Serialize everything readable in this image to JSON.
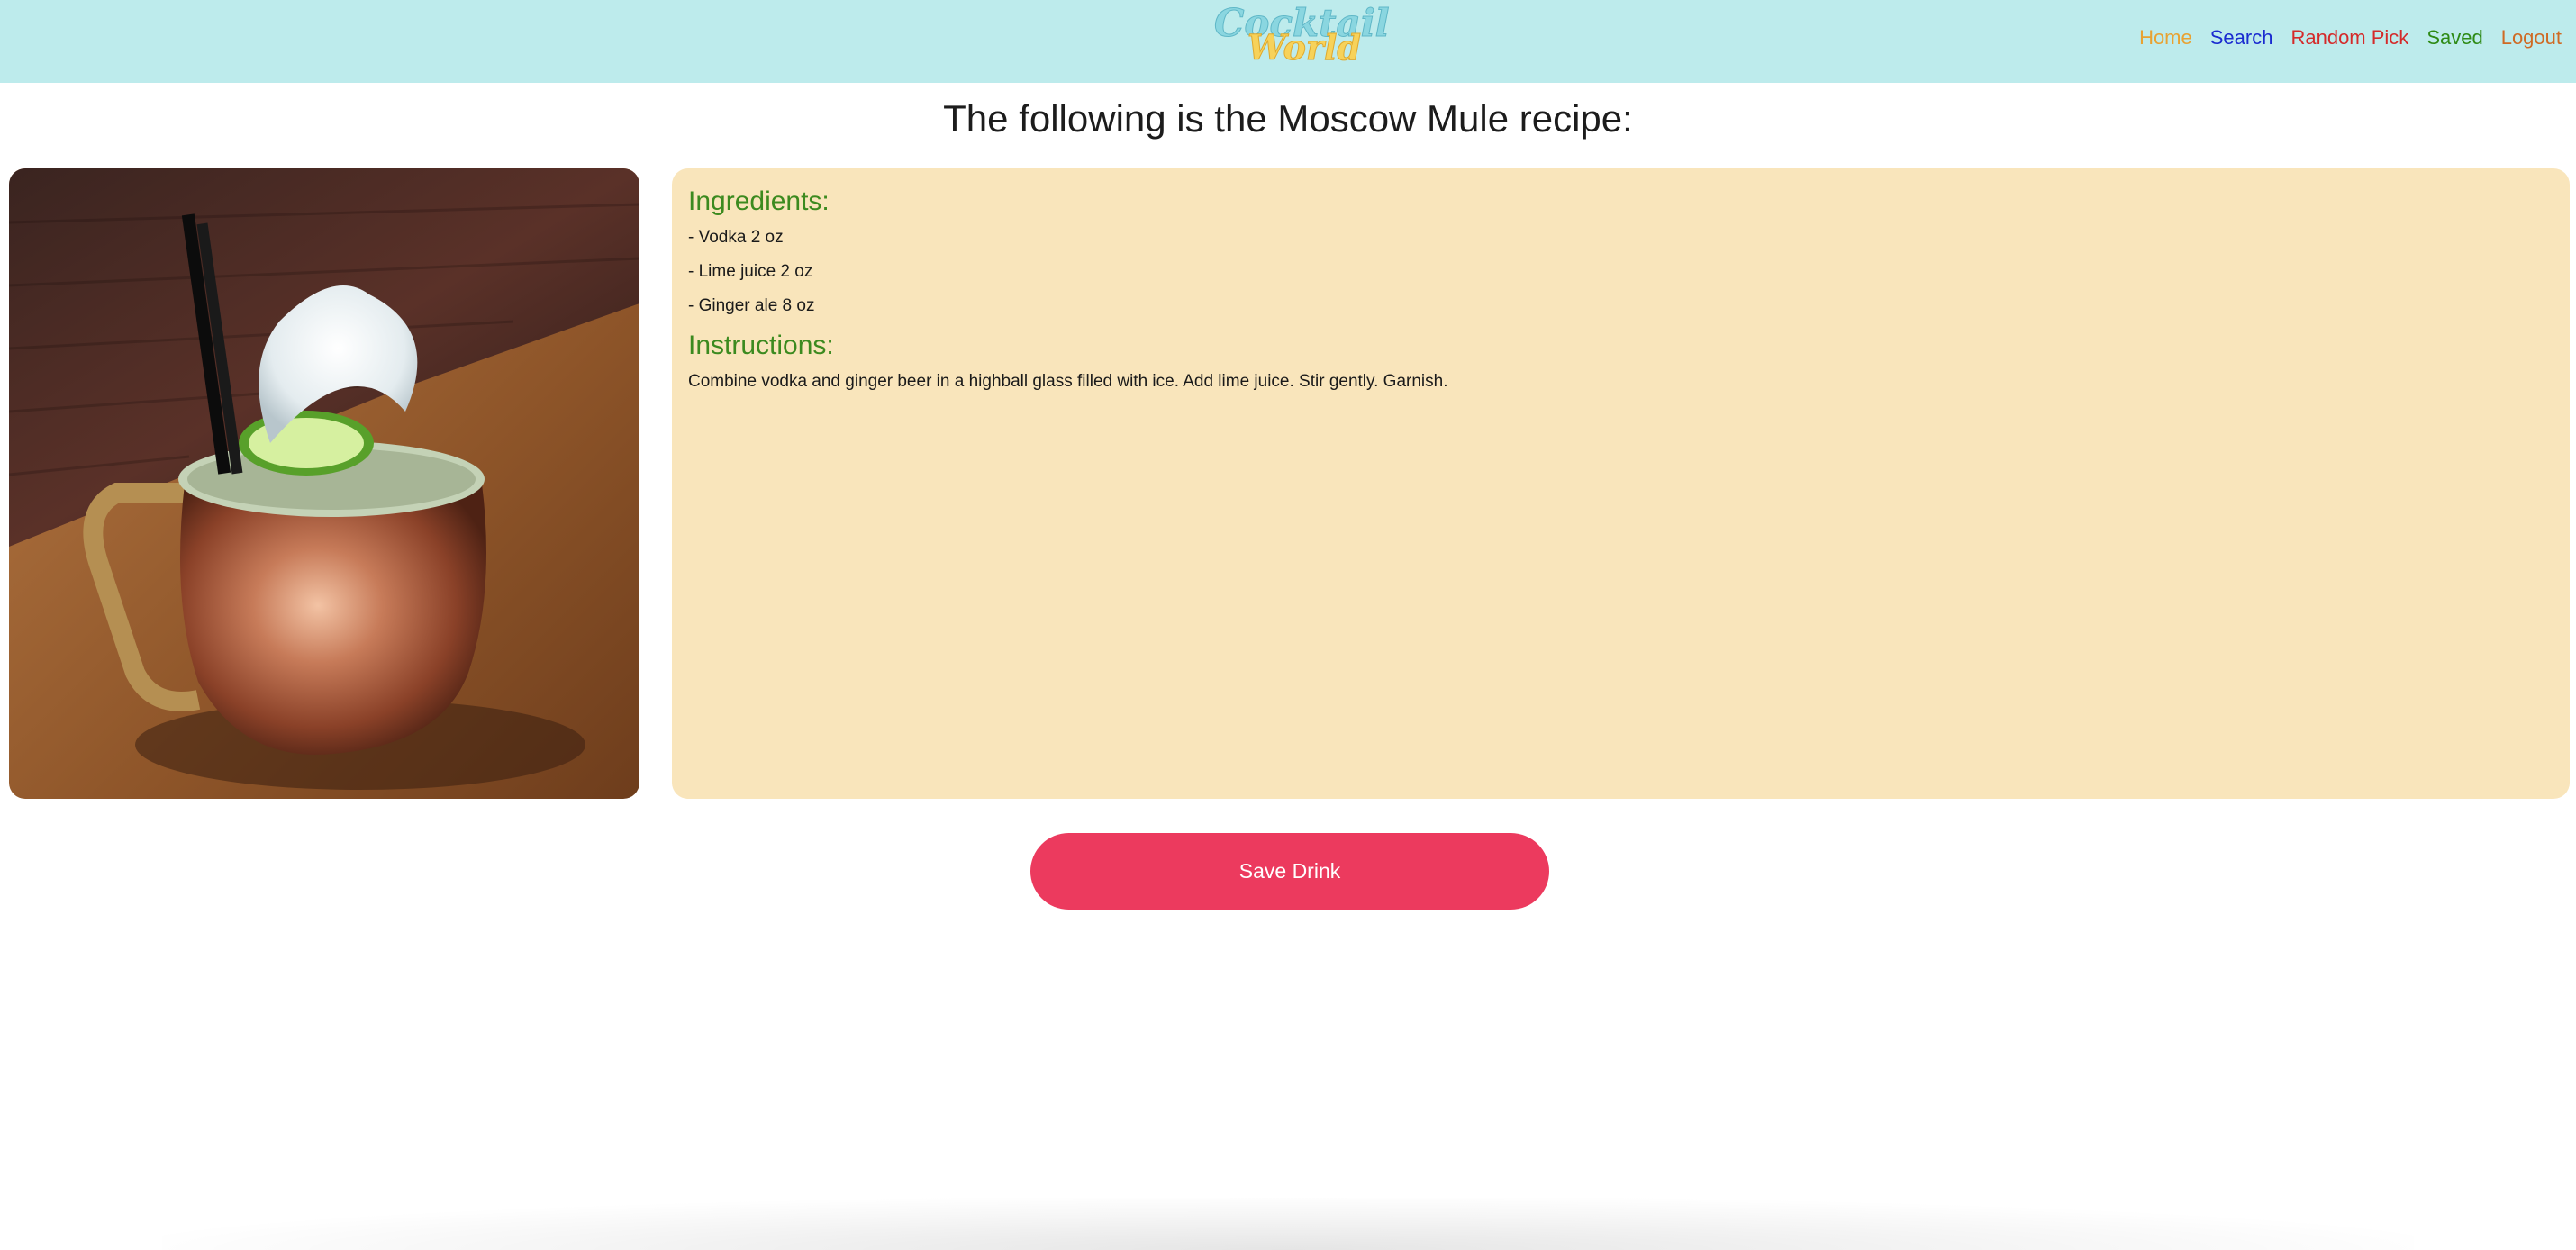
{
  "brand": {
    "logo_text_line1": "Cocktail",
    "logo_text_line2": "World"
  },
  "nav": {
    "items": [
      {
        "label": "Home",
        "color": "#e8a232"
      },
      {
        "label": "Search",
        "color": "#1a2bd0"
      },
      {
        "label": "Random Pick",
        "color": "#d42a2a"
      },
      {
        "label": "Saved",
        "color": "#2e8a16"
      },
      {
        "label": "Logout",
        "color": "#cf6a24"
      }
    ]
  },
  "page": {
    "title": "The following is the Moscow Mule recipe:"
  },
  "recipe": {
    "ingredients_heading": "Ingredients:",
    "ingredients": [
      "- Vodka 2 oz",
      "- Lime juice 2 oz",
      "- Ginger ale 8 oz"
    ],
    "instructions_heading": "Instructions:",
    "instructions": "Combine vodka and ginger beer in a highball glass filled with ice. Add lime juice. Stir gently. Garnish."
  },
  "actions": {
    "save_label": "Save Drink"
  },
  "colors": {
    "navbar_bg": "#bdebec",
    "card_bg": "#f9e5bb",
    "heading_green": "#3c8a1f",
    "save_button": "#ec3a5e"
  }
}
